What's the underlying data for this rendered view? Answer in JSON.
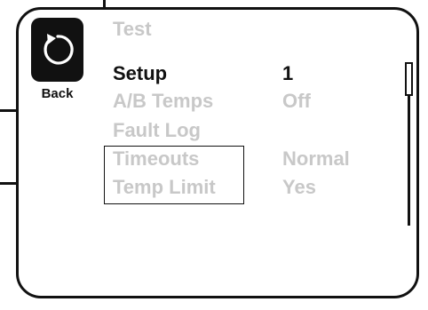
{
  "back": {
    "label": "Back",
    "icon": "back-arrow-icon"
  },
  "menu": {
    "items": [
      {
        "label": "Test",
        "value": "",
        "state": "dim"
      },
      {
        "label": "Setup",
        "value": "1",
        "state": "active"
      },
      {
        "label": "A/B Temps",
        "value": "Off",
        "state": "dim"
      },
      {
        "label": "Fault Log",
        "value": "",
        "state": "dim"
      },
      {
        "label": "Timeouts",
        "value": "Normal",
        "state": "dim"
      },
      {
        "label": "Temp Limit",
        "value": "Yes",
        "state": "dim"
      }
    ]
  },
  "scrollbar": {
    "position": 0
  },
  "colors": {
    "active_text": "#111111",
    "dim_text": "#c8c8c8",
    "frame": "#111111"
  }
}
